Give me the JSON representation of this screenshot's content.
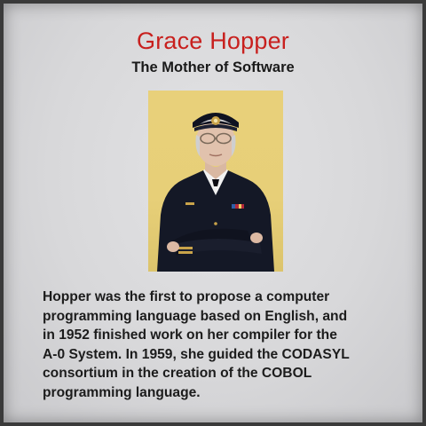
{
  "header": {
    "title": "Grace Hopper",
    "subtitle": "The Mother of Software"
  },
  "body": {
    "text": "Hopper was the first to propose a computer\nprogramming language based on English, and\nin 1952 finished work on her compiler for the\nA-0 System. In 1959, she guided the CODASYL\nconsortium in the creation of the COBOL\nprogramming language."
  },
  "colors": {
    "title": "#c8201e",
    "text": "#1c1c1c",
    "portrait_background": "#e7cf78",
    "uniform": "#141826"
  }
}
